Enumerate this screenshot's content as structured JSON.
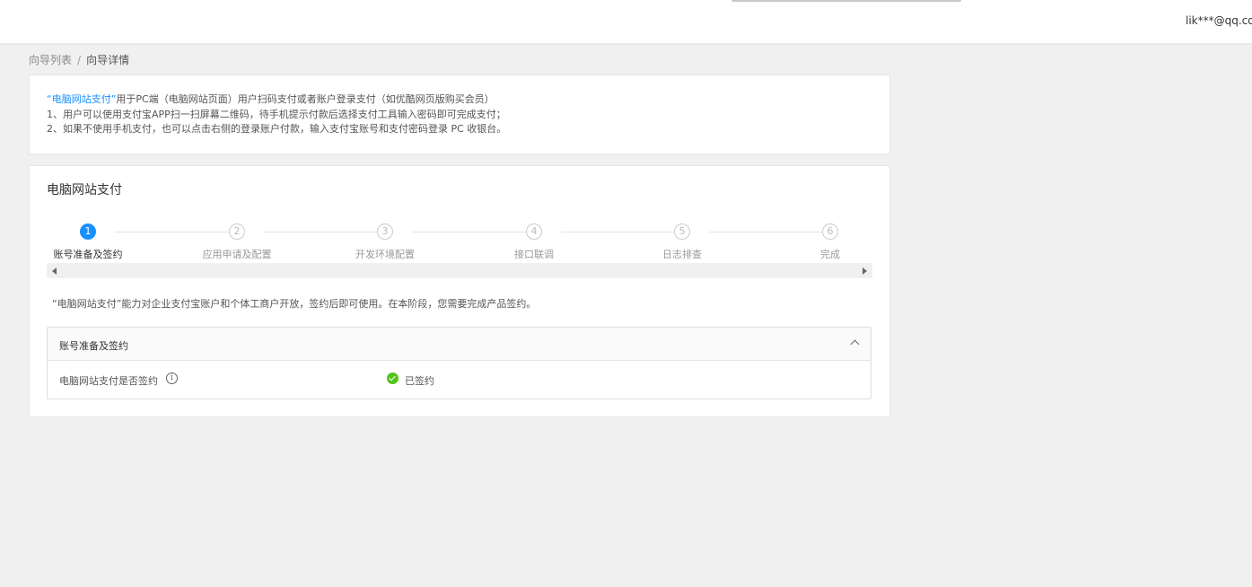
{
  "header": {
    "user_email": "lik***@qq.com"
  },
  "breadcrumb": {
    "items": [
      "向导列表",
      "向导详情"
    ],
    "separator": "/"
  },
  "intro": {
    "product_name": "“电脑网站支付”",
    "line1_rest": "用于PC端（电脑网站页面）用户扫码支付或者账户登录支付（如优酷网页版购买会员）",
    "line2": "1、用户可以使用支付宝APP扫一扫屏幕二维码，待手机提示付款后选择支付工具输入密码即可完成支付；",
    "line3": "2、如果不使用手机支付，也可以点击右侧的登录账户付款，输入支付宝账号和支付密码登录 PC 收银台。"
  },
  "main": {
    "title": "电脑网站支付",
    "steps": [
      {
        "number": "1",
        "label": "账号准备及签约",
        "active": true
      },
      {
        "number": "2",
        "label": "应用申请及配置",
        "active": false
      },
      {
        "number": "3",
        "label": "开发环境配置",
        "active": false
      },
      {
        "number": "4",
        "label": "接口联调",
        "active": false
      },
      {
        "number": "5",
        "label": "日志排查",
        "active": false
      },
      {
        "number": "6",
        "label": "完成",
        "active": false
      }
    ],
    "stage_description": "“电脑网站支付”能力对企业支付宝账户和个体工商户开放，签约后即可使用。在本阶段，您需要完成产品签约。",
    "panel": {
      "title": "账号准备及签约",
      "row_label": "电脑网站支付是否签约",
      "status": "已签约"
    }
  },
  "colors": {
    "accent": "#1890ff",
    "success": "#52c41a",
    "background": "#f0f0f0"
  },
  "icons": {
    "collapse": "chevron-up-icon",
    "info": "info-icon",
    "status": "check-circle-icon"
  }
}
